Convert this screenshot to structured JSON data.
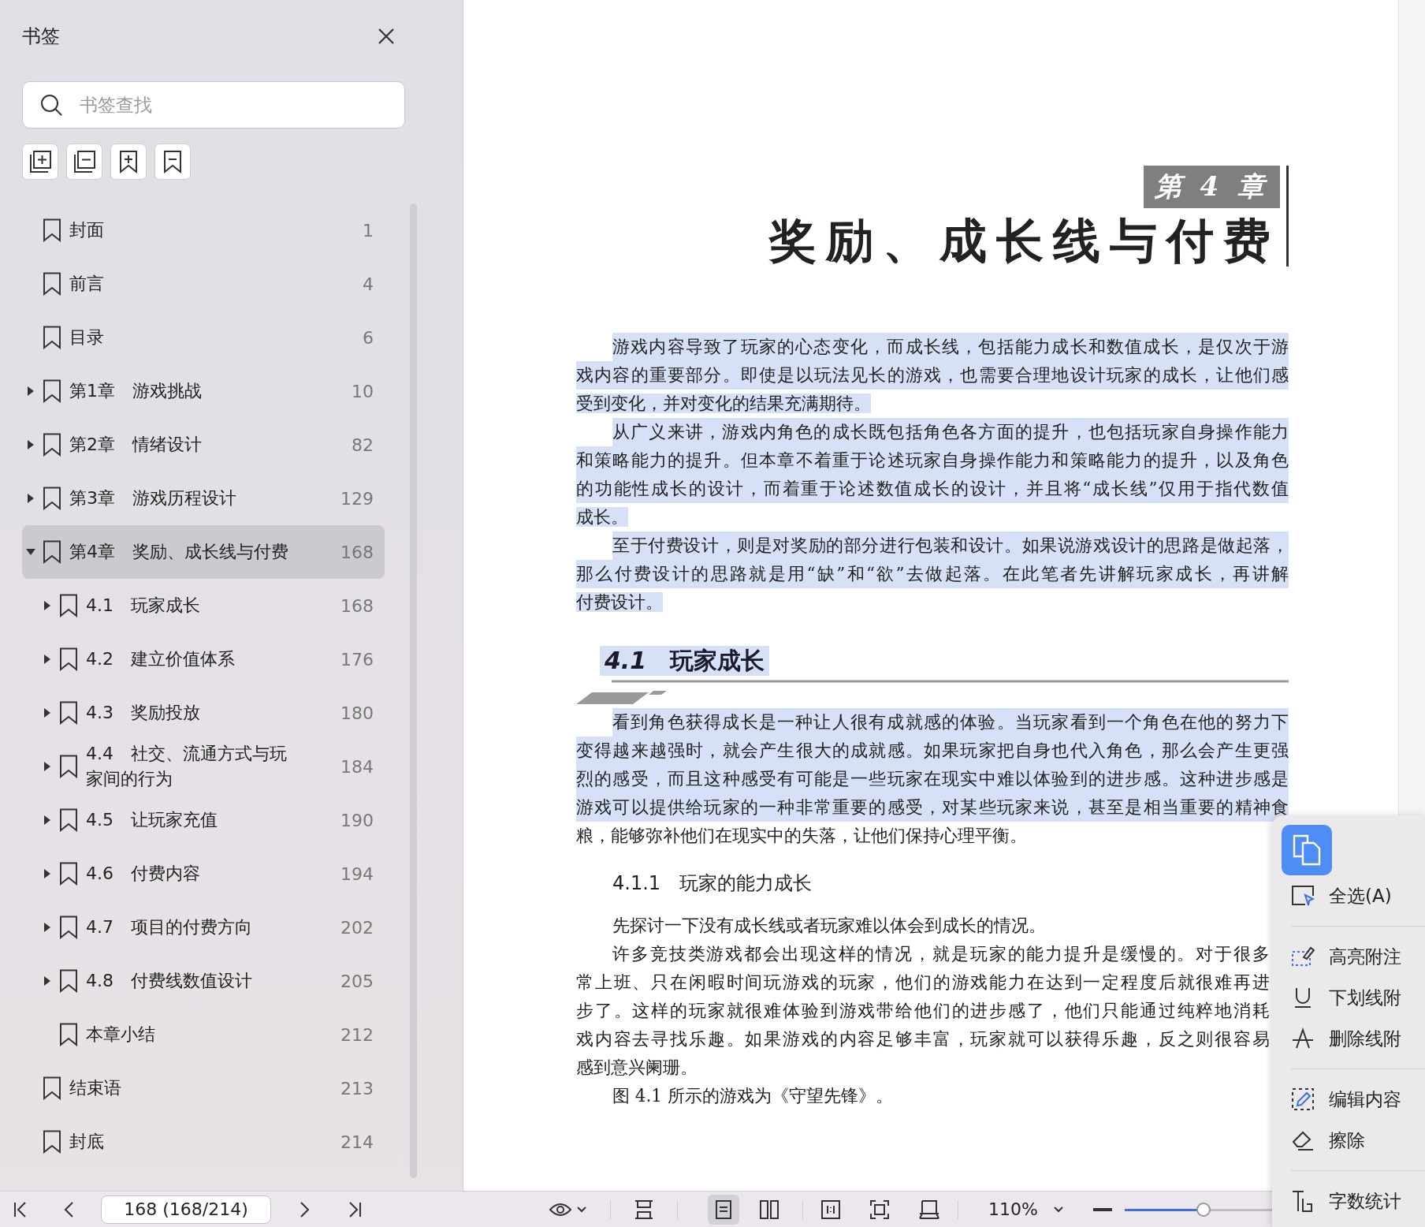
{
  "sidebar": {
    "title": "书签",
    "search": {
      "placeholder": "书签查找"
    },
    "items": [
      {
        "kind": "leaf",
        "label": "封面",
        "page": "1",
        "selected": false
      },
      {
        "kind": "leaf",
        "label": "前言",
        "page": "4",
        "selected": false
      },
      {
        "kind": "leaf",
        "label": "目录",
        "page": "6",
        "selected": false
      },
      {
        "kind": "folder",
        "expanded": false,
        "label": "第1章　游戏挑战",
        "page": "10",
        "selected": false
      },
      {
        "kind": "folder",
        "expanded": false,
        "label": "第2章　情绪设计",
        "page": "82",
        "selected": false
      },
      {
        "kind": "folder",
        "expanded": false,
        "label": "第3章　游戏历程设计",
        "page": "129",
        "selected": false
      },
      {
        "kind": "folder",
        "expanded": true,
        "label": "第4章　奖励、成长线与付费",
        "page": "168",
        "selected": true,
        "children": [
          {
            "kind": "folder",
            "expanded": false,
            "label": "4.1　玩家成长",
            "page": "168",
            "selected": false
          },
          {
            "kind": "folder",
            "expanded": false,
            "label": "4.2　建立价值体系",
            "page": "176",
            "selected": false
          },
          {
            "kind": "folder",
            "expanded": false,
            "label": "4.3　奖励投放",
            "page": "180",
            "selected": false
          },
          {
            "kind": "folder",
            "expanded": false,
            "label": "4.4　社交、流通方式与玩家间的行为",
            "page": "184",
            "selected": false
          },
          {
            "kind": "folder",
            "expanded": false,
            "label": "4.5　让玩家充值",
            "page": "190",
            "selected": false
          },
          {
            "kind": "folder",
            "expanded": false,
            "label": "4.6　付费内容",
            "page": "194",
            "selected": false
          },
          {
            "kind": "folder",
            "expanded": false,
            "label": "4.7　项目的付费方向",
            "page": "202",
            "selected": false
          },
          {
            "kind": "folder",
            "expanded": false,
            "label": "4.8　付费线数值设计",
            "page": "205",
            "selected": false
          },
          {
            "kind": "leaf",
            "label": "本章小结",
            "page": "212",
            "selected": false
          }
        ]
      },
      {
        "kind": "leaf",
        "label": "结束语",
        "page": "213",
        "selected": false
      },
      {
        "kind": "leaf",
        "label": "封底",
        "page": "214",
        "selected": false
      }
    ]
  },
  "document": {
    "chapter_label": "第 4 章",
    "chapter_title": "奖励、成长线与付费",
    "blocks": [
      {
        "kind": "paragraph",
        "covered": false,
        "lines": [
          {
            "text": "游戏内容导致了玩家的心态变化，而成长线，包括能力成长和数值成长，是仅次于游",
            "selected": true
          },
          {
            "text": "戏内容的重要部分。即使是以玩法见长的游戏，也需要合理地设计玩家的成长，让他们感",
            "selected": true
          },
          {
            "text": "受到变化，并对变化的结果充满期待。",
            "selected": true
          }
        ]
      },
      {
        "kind": "paragraph",
        "covered": false,
        "lines": [
          {
            "text": "从广义来讲，游戏内角色的成长既包括角色各方面的提升，也包括玩家自身操作能力",
            "selected": true
          },
          {
            "text": "和策略能力的提升。但本章不着重于论述玩家自身操作能力和策略能力的提升，以及角色",
            "selected": true
          },
          {
            "text": "的功能性成长的设计，而着重于论述数值成长的设计，并且将“成长线”仅用于指代数值",
            "selected": true
          },
          {
            "text": "成长。",
            "selected": true
          }
        ]
      },
      {
        "kind": "paragraph",
        "covered": false,
        "lines": [
          {
            "text": "至于付费设计，则是对奖励的部分进行包装和设计。如果说游戏设计的思路是做起落，",
            "selected": true
          },
          {
            "text": "那么付费设计的思路就是用“缺”和“欲”去做起落。在此笔者先讲解玩家成长，再讲解",
            "selected": true
          },
          {
            "text": "付费设计。",
            "selected": true
          }
        ]
      },
      {
        "kind": "section",
        "number": "4.1",
        "title": "玩家成长",
        "selected": true
      },
      {
        "kind": "paragraph",
        "covered": false,
        "lines": [
          {
            "text": "看到角色获得成长是一种让人很有成就感的体验。当玩家看到一个角色在他的努力下",
            "selected": true
          },
          {
            "text": "变得越来越强时，就会产生很大的成就感。如果玩家把自身也代入角色，那么会产生更强",
            "selected": true
          },
          {
            "text": "烈的感受，而且这种感受有可能是一些玩家在现实中难以体验到的进步感。这种进步感是",
            "selected": true
          },
          {
            "text": "游戏可以提供给玩家的一种非常重要的感受，对某些玩家来说，甚至是相当重要的精神食",
            "selected": true
          },
          {
            "text": "粮，能够弥补他们在现实中的失落，让他们保持心理平衡。",
            "selected": false
          }
        ]
      },
      {
        "kind": "subsection",
        "number": "4.1.1",
        "title": "玩家的能力成长"
      },
      {
        "kind": "paragraph",
        "covered": false,
        "lines": [
          {
            "text": "先探讨一下没有成长线或者玩家难以体会到成长的情况。",
            "selected": false
          }
        ]
      },
      {
        "kind": "paragraph",
        "covered": true,
        "lines": [
          {
            "text": "许多竞技类游戏都会出现这样的情况，就是玩家的能力提升是缓慢的。对于很多",
            "selected": false
          },
          {
            "text": "常上班、只在闲暇时间玩游戏的玩家，他们的游戏能力在达到一定程度后就很难再进",
            "selected": false
          },
          {
            "text": "步了。这样的玩家就很难体验到游戏带给他们的进步感了，他们只能通过纯粹地消耗",
            "selected": false
          },
          {
            "text": "戏内容去寻找乐趣。如果游戏的内容足够丰富，玩家就可以获得乐趣，反之则很容易",
            "selected": false
          },
          {
            "text": "感到意兴阑珊。",
            "selected": false
          }
        ]
      },
      {
        "kind": "paragraph",
        "covered": false,
        "lines": [
          {
            "text": "图 4.1 所示的游戏为《守望先锋》。",
            "selected": false
          }
        ]
      }
    ]
  },
  "context_menu": {
    "items": [
      {
        "kind": "select_all",
        "label": "全选(A)"
      },
      {
        "kind": "separator"
      },
      {
        "kind": "highlight",
        "label": "高亮附注"
      },
      {
        "kind": "underline",
        "label": "下划线附"
      },
      {
        "kind": "strikethrough",
        "label": "删除线附"
      },
      {
        "kind": "separator"
      },
      {
        "kind": "edit",
        "label": "编辑内容"
      },
      {
        "kind": "erase",
        "label": "擦除"
      },
      {
        "kind": "separator"
      },
      {
        "kind": "word_count",
        "label": "字数统计"
      }
    ]
  },
  "status_bar": {
    "page_field": "168 (168/214)",
    "zoom": "110%",
    "zoom_slider": {
      "level": 0.42
    },
    "view_modes": [
      {
        "kind": "fit_width",
        "selected": false
      },
      {
        "kind": "single",
        "selected": true
      },
      {
        "kind": "double",
        "selected": false
      }
    ]
  }
}
